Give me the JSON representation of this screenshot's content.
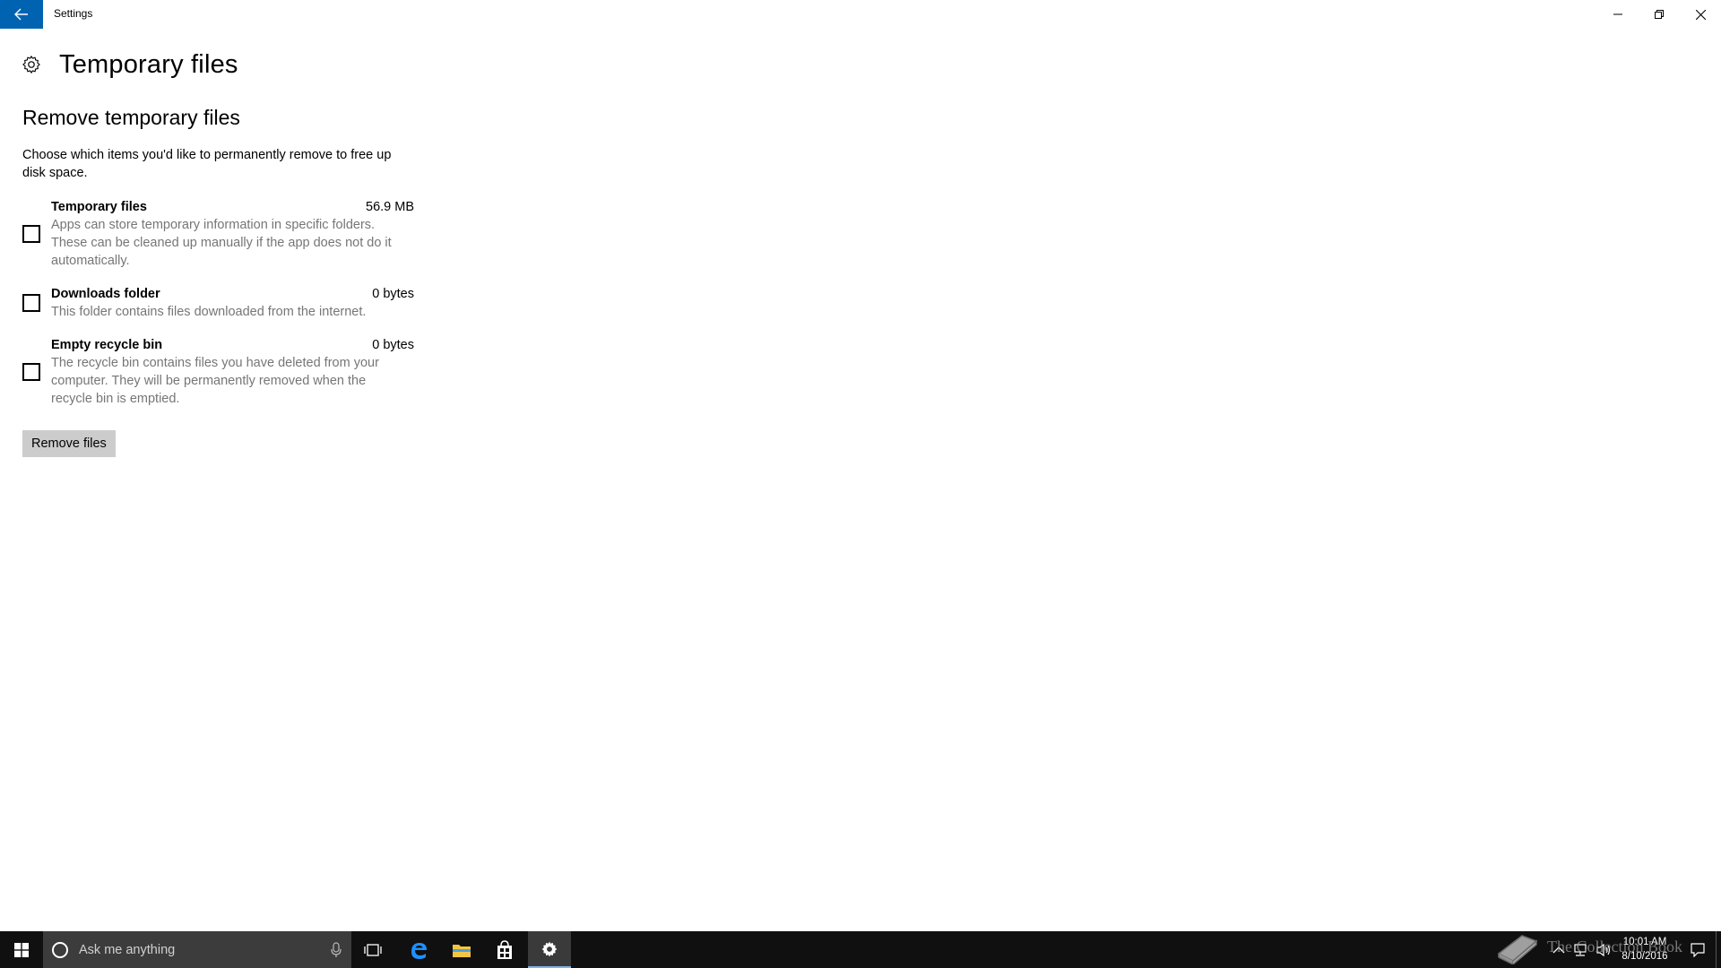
{
  "window": {
    "app_title": "Settings"
  },
  "page": {
    "title": "Temporary files"
  },
  "section": {
    "title": "Remove temporary files",
    "intro": "Choose which items you'd like to permanently remove to free up disk space."
  },
  "items": [
    {
      "name": "Temporary files",
      "size": "56.9 MB",
      "description": "Apps can store temporary information in specific folders. These can be cleaned up manually if the app does not do it automatically.",
      "checked": false
    },
    {
      "name": "Downloads folder",
      "size": "0 bytes",
      "description": "This folder contains files downloaded from the internet.",
      "checked": false
    },
    {
      "name": "Empty recycle bin",
      "size": "0 bytes",
      "description": "The recycle bin contains files you have deleted from your computer. They will be permanently removed when the recycle bin is emptied.",
      "checked": false
    }
  ],
  "actions": {
    "remove_label": "Remove files"
  },
  "taskbar": {
    "search_placeholder": "Ask me anything",
    "time": "10:01 AM",
    "date": "8/10/2016",
    "watermark": "The Collection Book",
    "pinned": [
      "task-view-icon",
      "edge-icon",
      "file-explorer-icon",
      "store-icon",
      "settings-icon"
    ]
  },
  "colors": {
    "accent": "#0063b1",
    "button_bg": "#cccccc",
    "secondary_text": "#767676",
    "taskbar_bg": "#101010"
  }
}
